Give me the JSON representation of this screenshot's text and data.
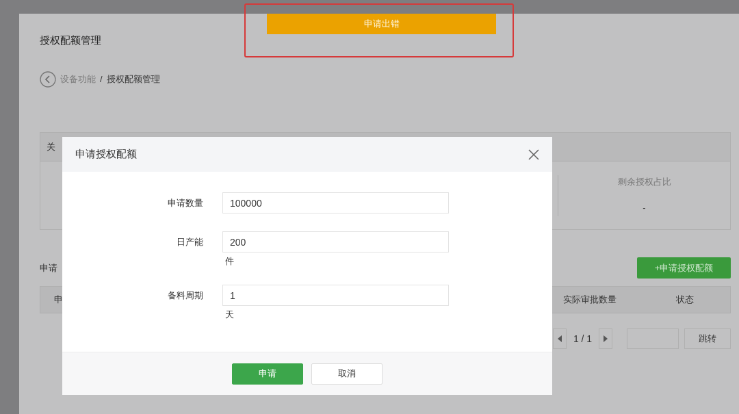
{
  "banner": {
    "label": "申请出错"
  },
  "page": {
    "title": "授权配额管理",
    "breadcrumb": [
      {
        "label": "设备功能",
        "current": false
      },
      {
        "label": "授权配额管理",
        "current": true
      }
    ],
    "breadcrumb_separator": "/",
    "stats": {
      "header_label": "关",
      "column_label": "剩余授权占比",
      "column_value": "-"
    },
    "list": {
      "title": "申请",
      "add_button": "+申请授权配额",
      "columns": [
        "申",
        "实际审批数量",
        "状态"
      ]
    },
    "pagination": {
      "page": "1 / 1",
      "jump_button": "跳转"
    }
  },
  "dialog": {
    "title": "申请授权配额",
    "fields": [
      {
        "label": "申请数量",
        "value": "100000"
      },
      {
        "label": "日产能",
        "value": "200",
        "unit": "件"
      },
      {
        "label": "备料周期",
        "value": "1",
        "unit": "天"
      }
    ],
    "buttons": [
      {
        "label": "申请",
        "kind": "primary"
      },
      {
        "label": "取消",
        "kind": "secondary"
      }
    ]
  }
}
